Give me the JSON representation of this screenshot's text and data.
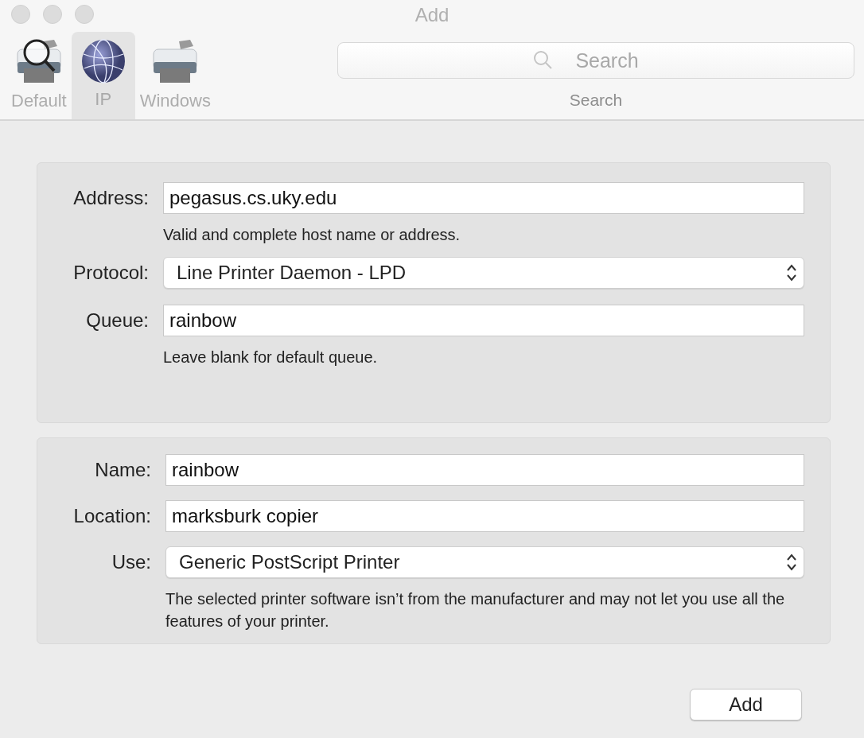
{
  "window": {
    "title": "Add"
  },
  "toolbar": {
    "tabs": [
      {
        "label": "Default",
        "selected": false,
        "kind": "printer-search"
      },
      {
        "label": "IP",
        "selected": true,
        "kind": "globe"
      },
      {
        "label": "Windows",
        "selected": false,
        "kind": "printer"
      }
    ],
    "search": {
      "placeholder": "Search",
      "label": "Search"
    }
  },
  "sections": [
    {
      "fields": [
        {
          "kind": "text",
          "label": "Address:",
          "value": "pegasus.cs.uky.edu",
          "hint": "Valid and complete host name or address."
        },
        {
          "kind": "select",
          "label": "Protocol:",
          "value": "Line Printer Daemon - LPD"
        },
        {
          "kind": "text",
          "label": "Queue:",
          "value": "rainbow",
          "hint": "Leave blank for default queue."
        }
      ]
    },
    {
      "fields": [
        {
          "kind": "text",
          "label": "Name:",
          "value": "rainbow"
        },
        {
          "kind": "text",
          "label": "Location:",
          "value": "marksburk copier"
        },
        {
          "kind": "select",
          "label": "Use:",
          "value": "Generic PostScript Printer",
          "hint": "The selected printer software isn’t from the manufacturer and may not let you use all the features of your printer."
        }
      ]
    }
  ],
  "buttons": [
    {
      "label": "Add"
    }
  ]
}
